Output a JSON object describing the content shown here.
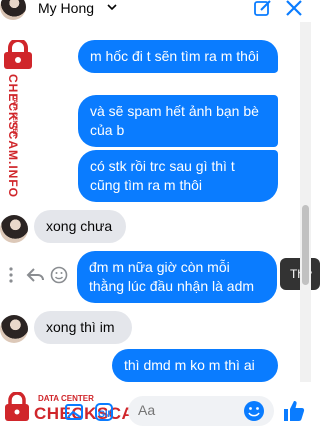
{
  "header": {
    "contact_name": "My Hong"
  },
  "watermark": {
    "brand": "CHECKSCAM.INFO",
    "tag": "DATA CENTER"
  },
  "messages": [
    {
      "dir": "out",
      "text": "m hốc đi t sẽn tìm ra m thôi"
    },
    {
      "dir": "out",
      "text": "và sẽ spam hết ảnh bạn bè của b"
    },
    {
      "dir": "out",
      "text": "có stk rồi trc sau gì thì   t cũng tìm ra m thôi"
    },
    {
      "dir": "in",
      "text": "xong chưa"
    },
    {
      "dir": "out",
      "text": "đm m nữa giờ còn mỗi thằng lúc đầu nhận là adm"
    },
    {
      "dir": "in",
      "text": "xong thì im"
    },
    {
      "dir": "out",
      "text": "thì dmd m ko m thì ai"
    }
  ],
  "tooltip": {
    "text": "Thứ"
  },
  "composer": {
    "placeholder": "Aa"
  },
  "colors": {
    "outgoing": "#0a7cff",
    "incoming": "#e4e6eb",
    "accent": "#0a7cff",
    "watermark": "#d0262b"
  }
}
